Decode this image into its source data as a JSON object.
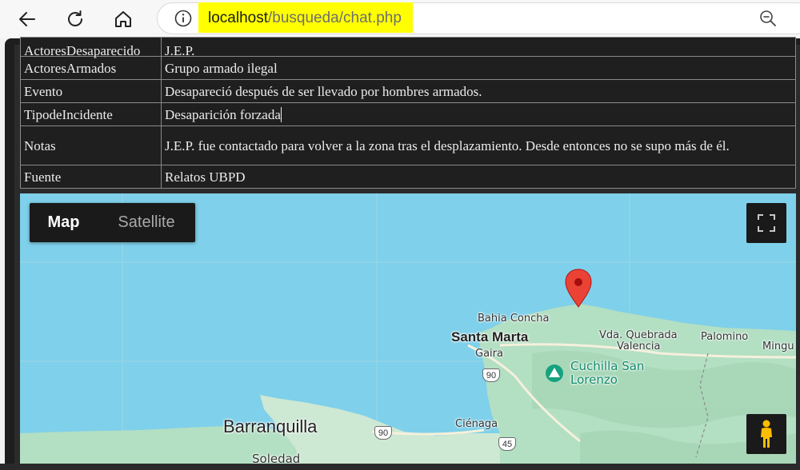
{
  "browser": {
    "url_host": "localhost",
    "url_path": "/busqueda/chat.php"
  },
  "table": {
    "rows": [
      {
        "key": "ActoresDesaparecido",
        "value": "J.E.P."
      },
      {
        "key": "ActoresArmados",
        "value": "Grupo armado ilegal"
      },
      {
        "key": "Evento",
        "value": "Desapareció después de ser llevado por hombres armados."
      },
      {
        "key": "TipodeIncidente",
        "value": "Desaparición forzada"
      },
      {
        "key": "Notas",
        "value": "J.E.P. fue contactado para volver a la zona tras el desplazamiento. Desde entonces no se supo más de él."
      },
      {
        "key": "Fuente",
        "value": "Relatos UBPD"
      }
    ]
  },
  "map": {
    "type_buttons": {
      "map": "Map",
      "satellite": "Satellite"
    },
    "selected_type": "Map",
    "labels": {
      "bahia_concha": "Bahia Concha",
      "santa_marta": "Santa Marta",
      "gaira": "Gaira",
      "quebrada": "Vda. Quebrada",
      "valencia": "Valencia",
      "palomino": "Palomino",
      "mingueo": "Mingu",
      "cuchilla_1": "Cuchilla San",
      "cuchilla_2": "Lorenzo",
      "cienaga": "Ciénaga",
      "barranquilla": "Barranquilla",
      "soledad": "Soledad",
      "route_90a": "90",
      "route_90b": "90",
      "route_45": "45"
    },
    "colors": {
      "water": "#7fd0ea",
      "land": "#b3dfc3",
      "marker": "#ea4335"
    }
  }
}
